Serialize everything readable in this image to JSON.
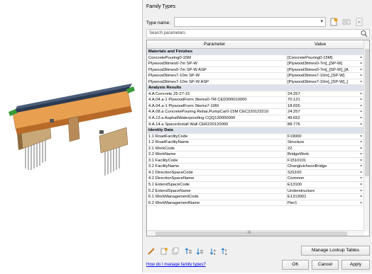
{
  "dialog": {
    "title": "Family Types",
    "type_name_label": "Type name:",
    "type_name_value": "",
    "search_placeholder": "Search parameters",
    "columns": {
      "parameter": "Parameter",
      "value": "Value"
    },
    "groups": [
      {
        "name": "Materials and Finishes",
        "rows": [
          {
            "p": "ConcretePouring0-15M",
            "v": "[ConcretePouring0-15M]",
            "f": "="
          },
          {
            "p": "Plywood3times0-7m SP-W",
            "v": "[Plywood3times0-7m]_[SP-W]",
            "f": "="
          },
          {
            "p": "Plywood3times0-7m SP-W ASP",
            "v": "[Plywood3times0-7m]_[SP-W]_[A",
            "f": "="
          },
          {
            "p": "Plywood3times7-10m SP-W",
            "v": "[Plywood3times7-10m]_[SP-W]",
            "f": "="
          },
          {
            "p": "Plywood3times7-10m SP-W ASP",
            "v": "[Plywood3times7-10m]_[SP-W]_[",
            "f": "="
          }
        ]
      },
      {
        "name": "Analysis Results",
        "rows": [
          {
            "p": "4.A Concrete 25-27-15",
            "v": "24.257",
            "f": "="
          },
          {
            "p": "4.A.04.a-1 PlywoodForm 3tiems0-7M CED300010000",
            "v": "70.121",
            "f": "="
          },
          {
            "p": "4.A.04.a-1 PlywoodForm 3tiems7-10M",
            "v": "18.655",
            "f": "="
          },
          {
            "p": "4.A.08.a ConcretePouring Rebar,PumpCar0-15M CEC220123210",
            "v": "24.257",
            "f": "="
          },
          {
            "p": "4.A.13.a AsphaltWaterproofing CQQ130000000",
            "v": "49.652",
            "f": "="
          },
          {
            "p": "4.A.14.a SpacerInstall Wall CER220120000",
            "v": "88.776",
            "f": "="
          }
        ]
      },
      {
        "name": "Identity Data",
        "rows": [
          {
            "p": "1.1 RoadFacilityCode",
            "v": "F19000",
            "f": "="
          },
          {
            "p": "1.2 RoadFacilityName",
            "v": "Structure",
            "f": "="
          },
          {
            "p": "2.1 WorkCode",
            "v": "22",
            "f": "="
          },
          {
            "p": "2.2 WorkName",
            "v": "BridgeWork",
            "f": "="
          },
          {
            "p": "3.1 FacilityCode",
            "v": "F1510101",
            "f": "="
          },
          {
            "p": "3.2 FacilityName",
            "v": "ChangiuicheonBridge",
            "f": "="
          },
          {
            "p": "4.1 DirectionSpaceCode",
            "v": "S31100",
            "f": "="
          },
          {
            "p": "4.2 DirectionSpaceName",
            "v": "Common",
            "f": "="
          },
          {
            "p": "5.1 ExtendSpaceCode",
            "v": "E13100",
            "f": "="
          },
          {
            "p": "5.2 ExtendSpaceName",
            "v": "Understructure",
            "f": "="
          },
          {
            "p": "6.1 WorkManagementCode",
            "v": "E1313001",
            "f": "="
          },
          {
            "p": "6.2 WorkManagementName",
            "v": "Pier1",
            "f": "="
          }
        ]
      }
    ],
    "hscroll_grip": "III",
    "manage_lookup_label": "Manage Lookup Tables",
    "help_link": "How do I manage family types?",
    "ok_label": "OK",
    "cancel_label": "Cancel",
    "apply_label": "Apply"
  },
  "colors": {
    "accent": "#1a73c8",
    "group_bg": "#dde2ea",
    "link": "#0000ee"
  }
}
